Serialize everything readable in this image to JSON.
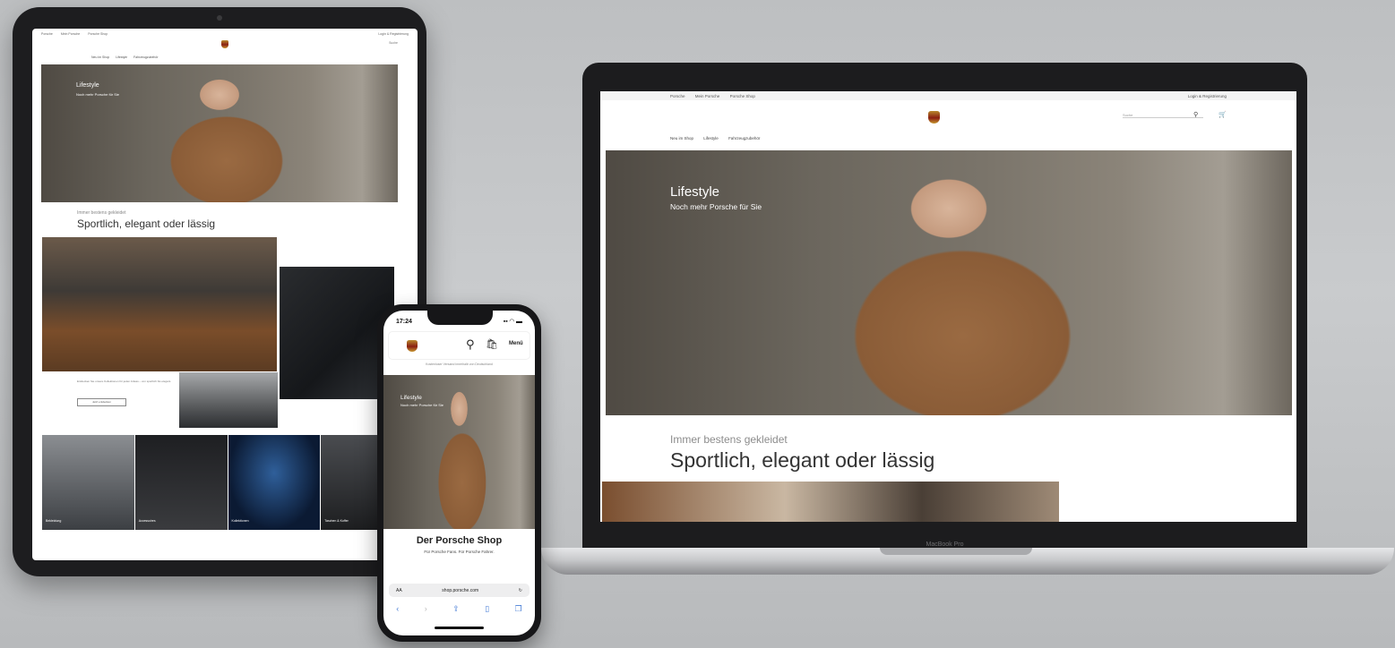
{
  "tablet": {
    "top_links": [
      "Porsche",
      "Mein Porsche",
      "Porsche Shop"
    ],
    "account": "Login & Registrierung",
    "search_placeholder": "Suche",
    "categories": [
      "Neu im Shop",
      "Lifestyle",
      "Fahrzeugzubehör"
    ],
    "hero": {
      "title": "Lifestyle",
      "subtitle": "Noch mehr Porsche für Sie"
    },
    "eyebrow": "Immer bestens gekleidet",
    "heading": "Sportlich, elegant oder lässig",
    "promo_text": "Entdecken Sie unsere Kollektionen für jeden Anlass – von sportlich bis elegant.",
    "promo_button": "Jetzt entdecken",
    "tiles": [
      "Bekleidung",
      "Accessoires",
      "Kollektionen",
      "Taschen & Koffer"
    ]
  },
  "laptop": {
    "brand": "MacBook Pro",
    "top_links": [
      "Porsche",
      "Mein Porsche",
      "Porsche Shop"
    ],
    "account": "Login & Registrierung",
    "search_placeholder": "Suche",
    "categories": [
      "Neu im Shop",
      "Lifestyle",
      "Fahrzeugzubehör"
    ],
    "hero": {
      "title": "Lifestyle",
      "subtitle": "Noch mehr Porsche für Sie"
    },
    "eyebrow": "Immer bestens gekleidet",
    "heading": "Sportlich, elegant oder lässig"
  },
  "phone": {
    "time": "17:24",
    "status_icons": "▪▪ ◠ ▬",
    "menu_label": "Menü",
    "banner": "Kostenloser Versand innerhalb von Deutschland",
    "hero": {
      "title": "Lifestyle",
      "subtitle": "Noch mehr Porsche für Sie"
    },
    "title": "Der Porsche Shop",
    "subtitle": "Für Porsche Fans. Für Porsche Fahrer.",
    "url_left": "AA",
    "url": "shop.porsche.com",
    "reload": "↻"
  },
  "colors": {
    "background": "#c5c7c9",
    "device_frame": "#1c1c1e",
    "crest_gold": "#b8892d",
    "crest_red": "#8a1f12"
  },
  "icons": [
    "search-icon",
    "bag-icon",
    "cart-icon",
    "reload-icon",
    "back-icon",
    "forward-icon",
    "share-icon",
    "bookmarks-icon",
    "tabs-icon"
  ]
}
